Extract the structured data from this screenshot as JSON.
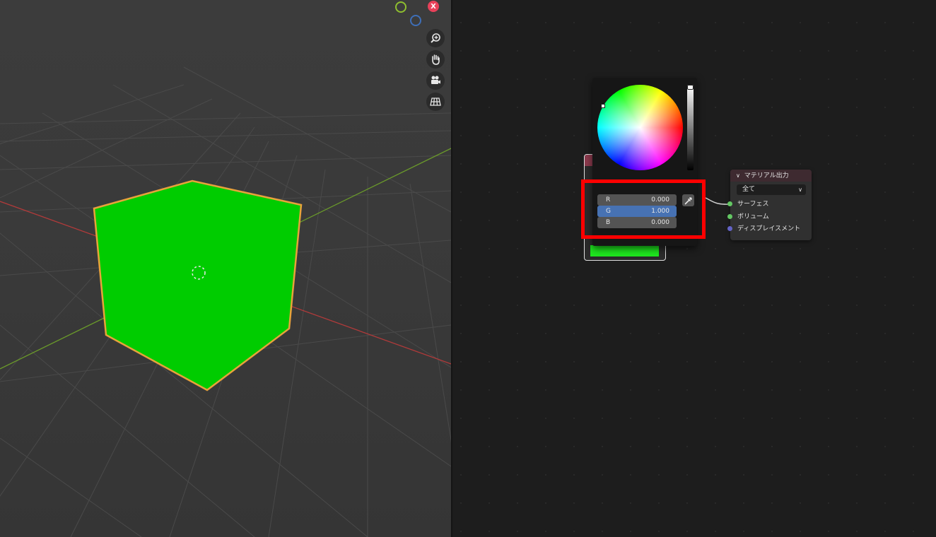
{
  "viewport": {
    "gizmo": {
      "x_label": "X"
    },
    "nav_buttons": [
      "zoom-icon",
      "pan-icon",
      "camera-icon",
      "grid-icon"
    ],
    "colors": {
      "cube": "#00cc00",
      "outline": "#e8a33a",
      "x_axis": "#b03a3a",
      "y_axis": "#6a9a2a"
    }
  },
  "color_picker": {
    "fields": [
      {
        "label": "R",
        "value": "0.000"
      },
      {
        "label": "G",
        "value": "1.000"
      },
      {
        "label": "B",
        "value": "0.000"
      }
    ],
    "active_field": "G",
    "current_color": "#1ee61e"
  },
  "material_output": {
    "title": "マテリアル出力",
    "target": "全て",
    "sockets": [
      {
        "label": "サーフェス",
        "color": "#63c763"
      },
      {
        "label": "ボリューム",
        "color": "#63c763"
      },
      {
        "label": "ディスプレイスメント",
        "color": "#6363c7"
      }
    ]
  }
}
